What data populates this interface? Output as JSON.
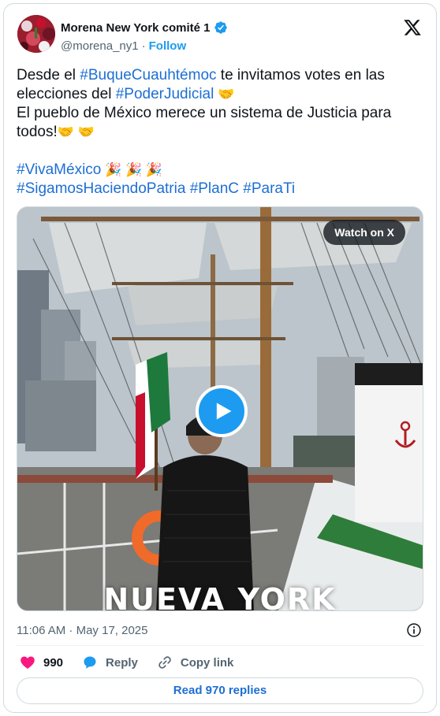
{
  "author": {
    "name": "Morena New York comité 1",
    "handle": "@morena_ny1",
    "separator": "·",
    "follow_label": "Follow"
  },
  "tweet": {
    "line1_prefix": "Desde el ",
    "tag1": "#BuqueCuauhtémoc",
    "line1_mid": " te invitamos votes en las elecciones del ",
    "tag2": "#PoderJudicial",
    "line1_emoji": " 🤝",
    "line2": "El pueblo de México merece un sistema de Justicia para todos!",
    "line2_emoji": "🤝 🤝",
    "tag3": "#VivaMéxico",
    "tag3_emoji": " 🎉 🎉 🎉",
    "tag4": "#SigamosHaciendoPatria",
    "tag5": "#PlanC",
    "tag6": "#ParaTi"
  },
  "media": {
    "watch_label": "Watch on X",
    "overlay_caption": "NUEVA YORK"
  },
  "meta": {
    "timestamp": "11:06 AM · May 17, 2025"
  },
  "actions": {
    "like_count": "990",
    "reply_label": "Reply",
    "copy_label": "Copy link"
  },
  "footer": {
    "read_replies_label": "Read 970 replies"
  },
  "colors": {
    "link": "#1d6fd3",
    "accent": "#1d9bf0",
    "like": "#f91880",
    "muted": "#536471"
  },
  "icons": [
    "verified-badge-icon",
    "x-logo-icon",
    "play-icon",
    "info-icon",
    "heart-icon",
    "reply-bubble-icon",
    "link-icon"
  ]
}
